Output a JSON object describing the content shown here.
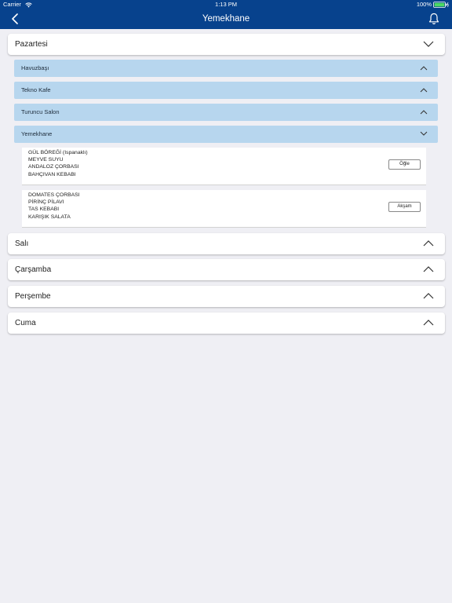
{
  "status": {
    "carrier": "Carrier",
    "time": "1:13 PM",
    "battery": "100%"
  },
  "navbar": {
    "title": "Yemekhane"
  },
  "days": {
    "monday": {
      "label": "Pazartesi"
    },
    "tuesday": {
      "label": "Salı"
    },
    "wednesday": {
      "label": "Çarşamba"
    },
    "thursday": {
      "label": "Perşembe"
    },
    "friday": {
      "label": "Cuma"
    }
  },
  "restaurants": [
    {
      "label": "Havuzbaşı",
      "expanded": false
    },
    {
      "label": "Tekno Kafe",
      "expanded": false
    },
    {
      "label": "Turuncu Salon",
      "expanded": false
    },
    {
      "label": "Yemekhane",
      "expanded": true
    }
  ],
  "meals": {
    "lunch": {
      "items": [
        "GÜL BÖREĞİ (Ispanaklı)",
        "MEYVE SUYU",
        "ANDALOZ ÇORBASI",
        "BAHÇIVAN KEBABI"
      ],
      "button": "Öğle"
    },
    "dinner": {
      "items": [
        "DOMATES ÇORBASI",
        "PİRİNÇ PİLAVI",
        "TAS KEBABI",
        "KARIŞIK SALATA"
      ],
      "button": "Akşam"
    }
  },
  "colors": {
    "header": "#07428d",
    "restaurant_row": "#b7d6ee",
    "background": "#efeff4"
  }
}
